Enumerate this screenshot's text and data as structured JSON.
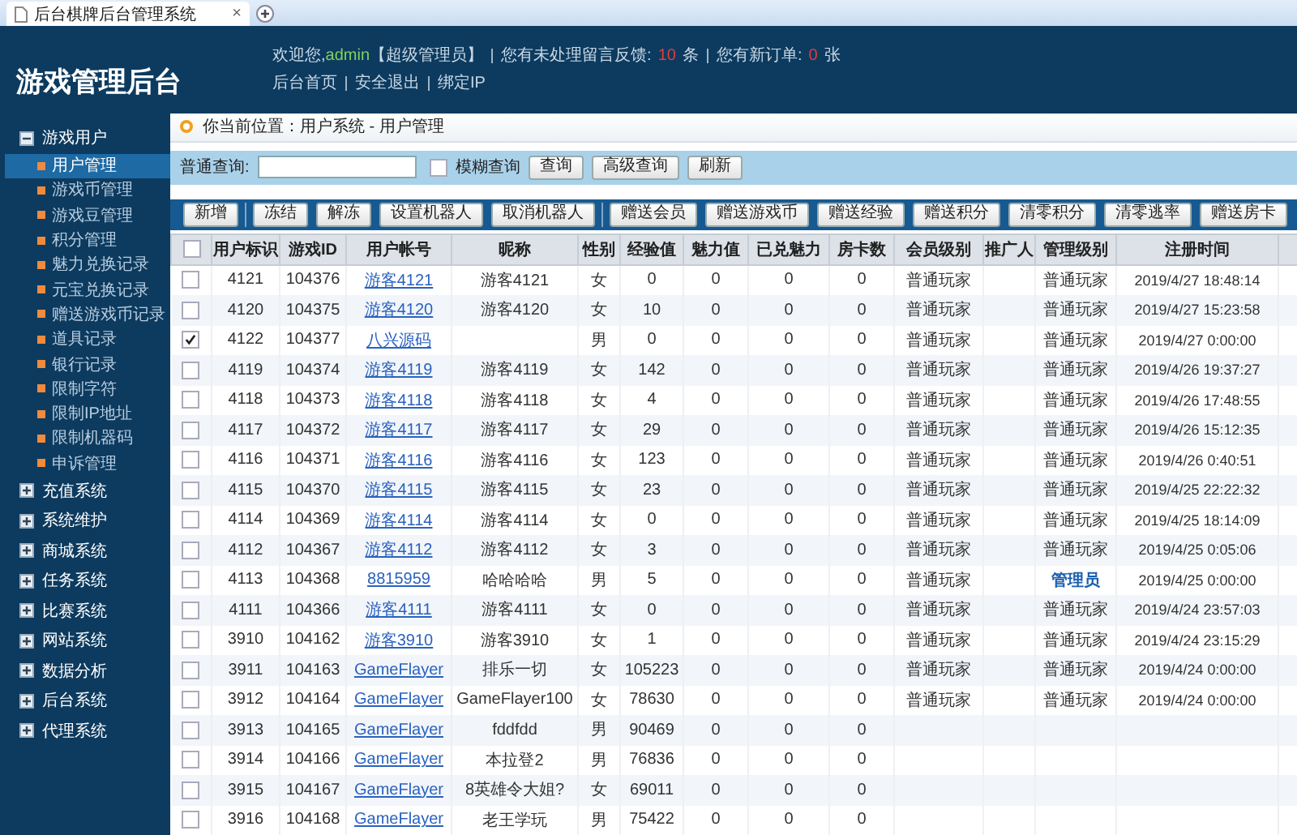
{
  "browser_tab": {
    "title": "后台棋牌后台管理系统",
    "close": "×"
  },
  "header": {
    "logo": "游戏管理后台",
    "welcome": "欢迎您,",
    "user": "admin",
    "role": "【超级管理员】",
    "feedback_text": "您有未处理留言反馈:",
    "feedback_count": "10",
    "feedback_unit": "条",
    "orders_text": "您有新订单:",
    "orders_count": "0",
    "orders_unit": "张",
    "links": [
      "后台首页",
      "安全退出",
      "绑定IP"
    ]
  },
  "sidebar": {
    "groups": [
      {
        "label": "游戏用户",
        "expanded": true,
        "items": [
          {
            "label": "用户管理",
            "selected": true
          },
          {
            "label": "游戏币管理",
            "selected": false
          },
          {
            "label": "游戏豆管理",
            "selected": false
          },
          {
            "label": "积分管理",
            "selected": false
          },
          {
            "label": "魅力兑换记录",
            "selected": false
          },
          {
            "label": "元宝兑换记录",
            "selected": false
          },
          {
            "label": "赠送游戏币记录",
            "selected": false
          },
          {
            "label": "道具记录",
            "selected": false
          },
          {
            "label": "银行记录",
            "selected": false
          },
          {
            "label": "限制字符",
            "selected": false
          },
          {
            "label": "限制IP地址",
            "selected": false
          },
          {
            "label": "限制机器码",
            "selected": false
          },
          {
            "label": "申诉管理",
            "selected": false
          }
        ]
      },
      {
        "label": "充值系统",
        "expanded": false
      },
      {
        "label": "系统维护",
        "expanded": false
      },
      {
        "label": "商城系统",
        "expanded": false
      },
      {
        "label": "任务系统",
        "expanded": false
      },
      {
        "label": "比赛系统",
        "expanded": false
      },
      {
        "label": "网站系统",
        "expanded": false
      },
      {
        "label": "数据分析",
        "expanded": false
      },
      {
        "label": "后台系统",
        "expanded": false
      },
      {
        "label": "代理系统",
        "expanded": false
      }
    ]
  },
  "breadcrumb": "你当前位置：用户系统 - 用户管理",
  "search": {
    "label": "普通查询:",
    "fuzzy": {
      "label": "模糊查询",
      "checked": false
    },
    "buttons": [
      "查询",
      "高级查询",
      "刷新"
    ]
  },
  "toolbar": {
    "groups": [
      [
        "新增"
      ],
      [
        "冻结",
        "解冻",
        "设置机器人",
        "取消机器人"
      ],
      [
        "赠送会员",
        "赠送游戏币",
        "赠送经验",
        "赠送积分",
        "清零积分",
        "清零逃率",
        "赠送房卡"
      ]
    ]
  },
  "table": {
    "select_all_checked": false,
    "columns": [
      "用户标识",
      "游戏ID",
      "用户帐号",
      "昵称",
      "性别",
      "经验值",
      "魅力值",
      "已兑魅力",
      "房卡数",
      "会员级别",
      "推广人",
      "管理级别",
      "注册时间"
    ],
    "rows": [
      {
        "checked": false,
        "user_id": "4121",
        "game_id": "104376",
        "account": "游客4121",
        "nickname": "游客4121",
        "gender": "女",
        "exp": "0",
        "charm": "0",
        "redeemed": "0",
        "cards": "0",
        "member_level": "普通玩家",
        "admin_level": "普通玩家",
        "admin_emphasis": false,
        "registered": "2019/4/27 18:48:14"
      },
      {
        "checked": false,
        "user_id": "4120",
        "game_id": "104375",
        "account": "游客4120",
        "nickname": "游客4120",
        "gender": "女",
        "exp": "10",
        "charm": "0",
        "redeemed": "0",
        "cards": "0",
        "member_level": "普通玩家",
        "admin_level": "普通玩家",
        "admin_emphasis": false,
        "registered": "2019/4/27 15:23:58"
      },
      {
        "checked": true,
        "user_id": "4122",
        "game_id": "104377",
        "account": "八兴源码",
        "gender": "男",
        "exp": "0",
        "charm": "0",
        "redeemed": "0",
        "cards": "0",
        "member_level": "普通玩家",
        "admin_level": "普通玩家",
        "admin_emphasis": false,
        "registered": "2019/4/27 0:00:00"
      },
      {
        "checked": false,
        "user_id": "4119",
        "game_id": "104374",
        "account": "游客4119",
        "nickname": "游客4119",
        "gender": "女",
        "exp": "142",
        "charm": "0",
        "redeemed": "0",
        "cards": "0",
        "member_level": "普通玩家",
        "admin_level": "普通玩家",
        "admin_emphasis": false,
        "registered": "2019/4/26 19:37:27"
      },
      {
        "checked": false,
        "user_id": "4118",
        "game_id": "104373",
        "account": "游客4118",
        "nickname": "游客4118",
        "gender": "女",
        "exp": "4",
        "charm": "0",
        "redeemed": "0",
        "cards": "0",
        "member_level": "普通玩家",
        "admin_level": "普通玩家",
        "admin_emphasis": false,
        "registered": "2019/4/26 17:48:55"
      },
      {
        "checked": false,
        "user_id": "4117",
        "game_id": "104372",
        "account": "游客4117",
        "nickname": "游客4117",
        "gender": "女",
        "exp": "29",
        "charm": "0",
        "redeemed": "0",
        "cards": "0",
        "member_level": "普通玩家",
        "admin_level": "普通玩家",
        "admin_emphasis": false,
        "registered": "2019/4/26 15:12:35"
      },
      {
        "checked": false,
        "user_id": "4116",
        "game_id": "104371",
        "account": "游客4116",
        "nickname": "游客4116",
        "gender": "女",
        "exp": "123",
        "charm": "0",
        "redeemed": "0",
        "cards": "0",
        "member_level": "普通玩家",
        "admin_level": "普通玩家",
        "admin_emphasis": false,
        "registered": "2019/4/26 0:40:51"
      },
      {
        "checked": false,
        "user_id": "4115",
        "game_id": "104370",
        "account": "游客4115",
        "nickname": "游客4115",
        "gender": "女",
        "exp": "23",
        "charm": "0",
        "redeemed": "0",
        "cards": "0",
        "member_level": "普通玩家",
        "admin_level": "普通玩家",
        "admin_emphasis": false,
        "registered": "2019/4/25 22:22:32"
      },
      {
        "checked": false,
        "user_id": "4114",
        "game_id": "104369",
        "account": "游客4114",
        "nickname": "游客4114",
        "gender": "女",
        "exp": "0",
        "charm": "0",
        "redeemed": "0",
        "cards": "0",
        "member_level": "普通玩家",
        "admin_level": "普通玩家",
        "admin_emphasis": false,
        "registered": "2019/4/25 18:14:09"
      },
      {
        "checked": false,
        "user_id": "4112",
        "game_id": "104367",
        "account": "游客4112",
        "nickname": "游客4112",
        "gender": "女",
        "exp": "3",
        "charm": "0",
        "redeemed": "0",
        "cards": "0",
        "member_level": "普通玩家",
        "admin_level": "普通玩家",
        "admin_emphasis": false,
        "registered": "2019/4/25 0:05:06"
      },
      {
        "checked": false,
        "user_id": "4113",
        "game_id": "104368",
        "account": "8815959",
        "nickname": "哈哈哈哈",
        "gender": "男",
        "exp": "5",
        "charm": "0",
        "redeemed": "0",
        "cards": "0",
        "member_level": "普通玩家",
        "admin_level": "管理员",
        "admin_emphasis": true,
        "registered": "2019/4/25 0:00:00"
      },
      {
        "checked": false,
        "user_id": "4111",
        "game_id": "104366",
        "account": "游客4111",
        "nickname": "游客4111",
        "gender": "女",
        "exp": "0",
        "charm": "0",
        "redeemed": "0",
        "cards": "0",
        "member_level": "普通玩家",
        "admin_level": "普通玩家",
        "admin_emphasis": false,
        "registered": "2019/4/24 23:57:03"
      },
      {
        "checked": false,
        "user_id": "3910",
        "game_id": "104162",
        "account": "游客3910",
        "nickname": "游客3910",
        "gender": "女",
        "exp": "1",
        "charm": "0",
        "redeemed": "0",
        "cards": "0",
        "member_level": "普通玩家",
        "admin_level": "普通玩家",
        "admin_emphasis": false,
        "registered": "2019/4/24 23:15:29"
      },
      {
        "checked": false,
        "user_id": "3911",
        "game_id": "104163",
        "account": "GameFlayer",
        "nickname": "排乐一切",
        "gender": "女",
        "exp": "105223",
        "charm": "0",
        "redeemed": "0",
        "cards": "0",
        "member_level": "普通玩家",
        "admin_level": "普通玩家",
        "admin_emphasis": false,
        "registered": "2019/4/24 0:00:00"
      },
      {
        "checked": false,
        "user_id": "3912",
        "game_id": "104164",
        "account": "GameFlayer",
        "nickname": "GameFlayer100",
        "gender": "女",
        "exp": "78630",
        "charm": "0",
        "redeemed": "0",
        "cards": "0",
        "member_level": "普通玩家",
        "admin_level": "普通玩家",
        "admin_emphasis": false,
        "registered": "2019/4/24 0:00:00"
      },
      {
        "checked": false,
        "user_id": "3913",
        "game_id": "104165",
        "account": "GameFlayer",
        "nickname": "fddfdd",
        "gender": "男",
        "exp": "90469",
        "charm": "0",
        "redeemed": "0",
        "cards": "0"
      },
      {
        "checked": false,
        "user_id": "3914",
        "game_id": "104166",
        "account": "GameFlayer",
        "nickname": "本拉登2",
        "gender": "男",
        "exp": "76836",
        "charm": "0",
        "redeemed": "0",
        "cards": "0"
      },
      {
        "checked": false,
        "user_id": "3915",
        "game_id": "104167",
        "account": "GameFlayer",
        "nickname": "8英雄令大姐?",
        "gender": "女",
        "exp": "69011",
        "charm": "0",
        "redeemed": "0",
        "cards": "0"
      },
      {
        "checked": false,
        "user_id": "3916",
        "game_id": "104168",
        "account": "GameFlayer",
        "nickname": "老王学玩",
        "gender": "男",
        "exp": "75422",
        "charm": "0",
        "redeemed": "0",
        "cards": "0"
      }
    ]
  }
}
